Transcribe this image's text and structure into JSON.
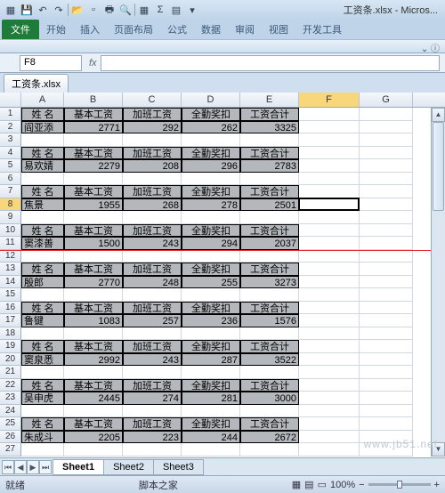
{
  "title_suffix": " - Micros...",
  "filename": "工资条.xlsx",
  "tabs": {
    "file": "文件",
    "home": "开始",
    "insert": "插入",
    "layout": "页面布局",
    "formula": "公式",
    "data": "数据",
    "review": "审阅",
    "view": "视图",
    "dev": "开发工具"
  },
  "namebox": "F8",
  "workbook_tab": "工资条.xlsx",
  "columns": [
    "A",
    "B",
    "C",
    "D",
    "E",
    "F",
    "G"
  ],
  "col_widths": {
    "A": 48,
    "B": 66,
    "C": 66,
    "D": 66,
    "E": 66,
    "F": 68,
    "G": 60
  },
  "header_labels": {
    "name": "姓 名",
    "base": "基本工资",
    "ot": "加班工资",
    "bonus": "全勤奖扣",
    "total": "工资合计"
  },
  "records": [
    {
      "name": "阎亚添",
      "base": 2771,
      "ot": 292,
      "bonus": 262,
      "total": 3325
    },
    {
      "name": "易欢婧",
      "base": 2279,
      "ot": 208,
      "bonus": 296,
      "total": 2783
    },
    {
      "name": "焦景",
      "base": 1955,
      "ot": 268,
      "bonus": 278,
      "total": 2501
    },
    {
      "name": "窦漆善",
      "base": 1500,
      "ot": 243,
      "bonus": 294,
      "total": 2037
    },
    {
      "name": "殷郎",
      "base": 2770,
      "ot": 248,
      "bonus": 255,
      "total": 3273
    },
    {
      "name": "鲁键",
      "base": 1083,
      "ot": 257,
      "bonus": 236,
      "total": 1576
    },
    {
      "name": "窦泉悉",
      "base": 2992,
      "ot": 243,
      "bonus": 287,
      "total": 3522
    },
    {
      "name": "吴申虎",
      "base": 2445,
      "ot": 274,
      "bonus": 281,
      "total": 3000
    },
    {
      "name": "朱成斗",
      "base": 2205,
      "ot": 223,
      "bonus": 244,
      "total": 2672
    }
  ],
  "sheets": [
    "Sheet1",
    "Sheet2",
    "Sheet3"
  ],
  "active_sheet": 0,
  "status_text": "就绪",
  "zoom": "100%",
  "watermark_site": "脚本之家",
  "watermark_url": "www.jb51.net",
  "active_cell": "F8",
  "redline_row": 11
}
